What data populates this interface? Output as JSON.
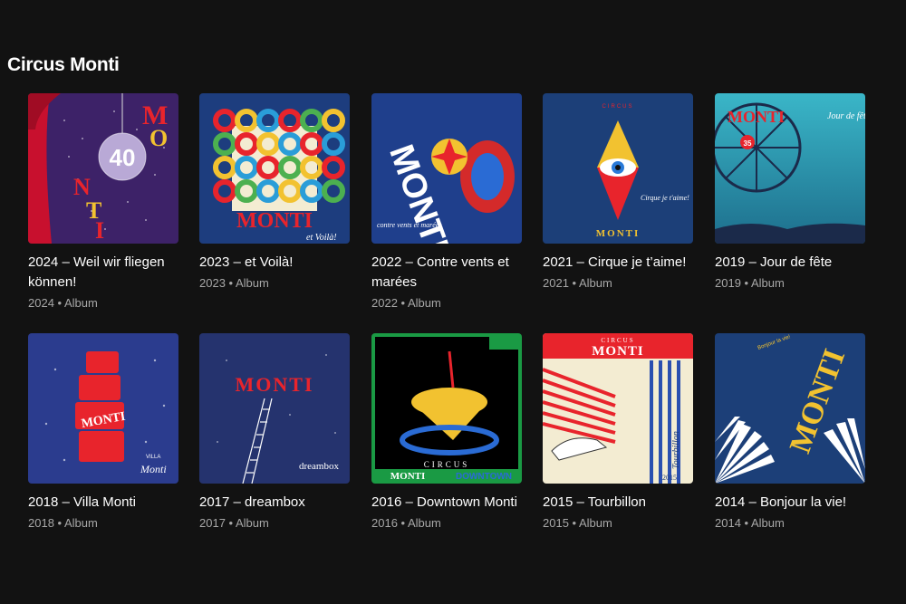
{
  "section": {
    "title": "Circus Monti"
  },
  "albums": [
    {
      "title": "2024 – Weil wir fliegen können!",
      "subtitle": "2024 • Album",
      "cover_text": [
        "M",
        "O",
        "N",
        "T",
        "I",
        "40"
      ]
    },
    {
      "title": "2023 – et Voilà!",
      "subtitle": "2023 • Album",
      "cover_text": [
        "MONTI",
        "et Voilà!"
      ]
    },
    {
      "title": "2022 – Contre vents et marées",
      "subtitle": "2022 • Album",
      "cover_text": [
        "MONTI",
        "contre vents et marées"
      ]
    },
    {
      "title": "2021 – Cirque je t’aime!",
      "subtitle": "2021 • Album",
      "cover_text": [
        "CIRCUS",
        "MONTI",
        "Cirque je t'aime!"
      ]
    },
    {
      "title": "2019 – Jour de fête",
      "subtitle": "2019 • Album",
      "cover_text": [
        "MONTI",
        "Jour de fête",
        "35"
      ]
    },
    {
      "title": "2018 – Villa Monti",
      "subtitle": "2018 • Album",
      "cover_text": [
        "MONTI",
        "VILLA",
        "Monti"
      ]
    },
    {
      "title": "2017 – dreambox",
      "subtitle": "2017 • Album",
      "cover_text": [
        "MONTI",
        "dreambox"
      ]
    },
    {
      "title": "2016 – Downtown Monti",
      "subtitle": "2016 • Album",
      "cover_text": [
        "CIRCUS",
        "MONTI",
        "DOWNTOWN"
      ]
    },
    {
      "title": "2015 – Tourbillon",
      "subtitle": "2015 • Album",
      "cover_text": [
        "CIRCUS",
        "MONTI",
        "Tourbillon",
        "2015"
      ]
    },
    {
      "title": "2014 – Bonjour la vie!",
      "subtitle": "2014 • Album",
      "cover_text": [
        "MONTI",
        "Bonjour la vie!"
      ]
    }
  ],
  "colors": {
    "background": "#121212",
    "text_primary": "#ffffff",
    "text_secondary": "#a7a7a7"
  }
}
